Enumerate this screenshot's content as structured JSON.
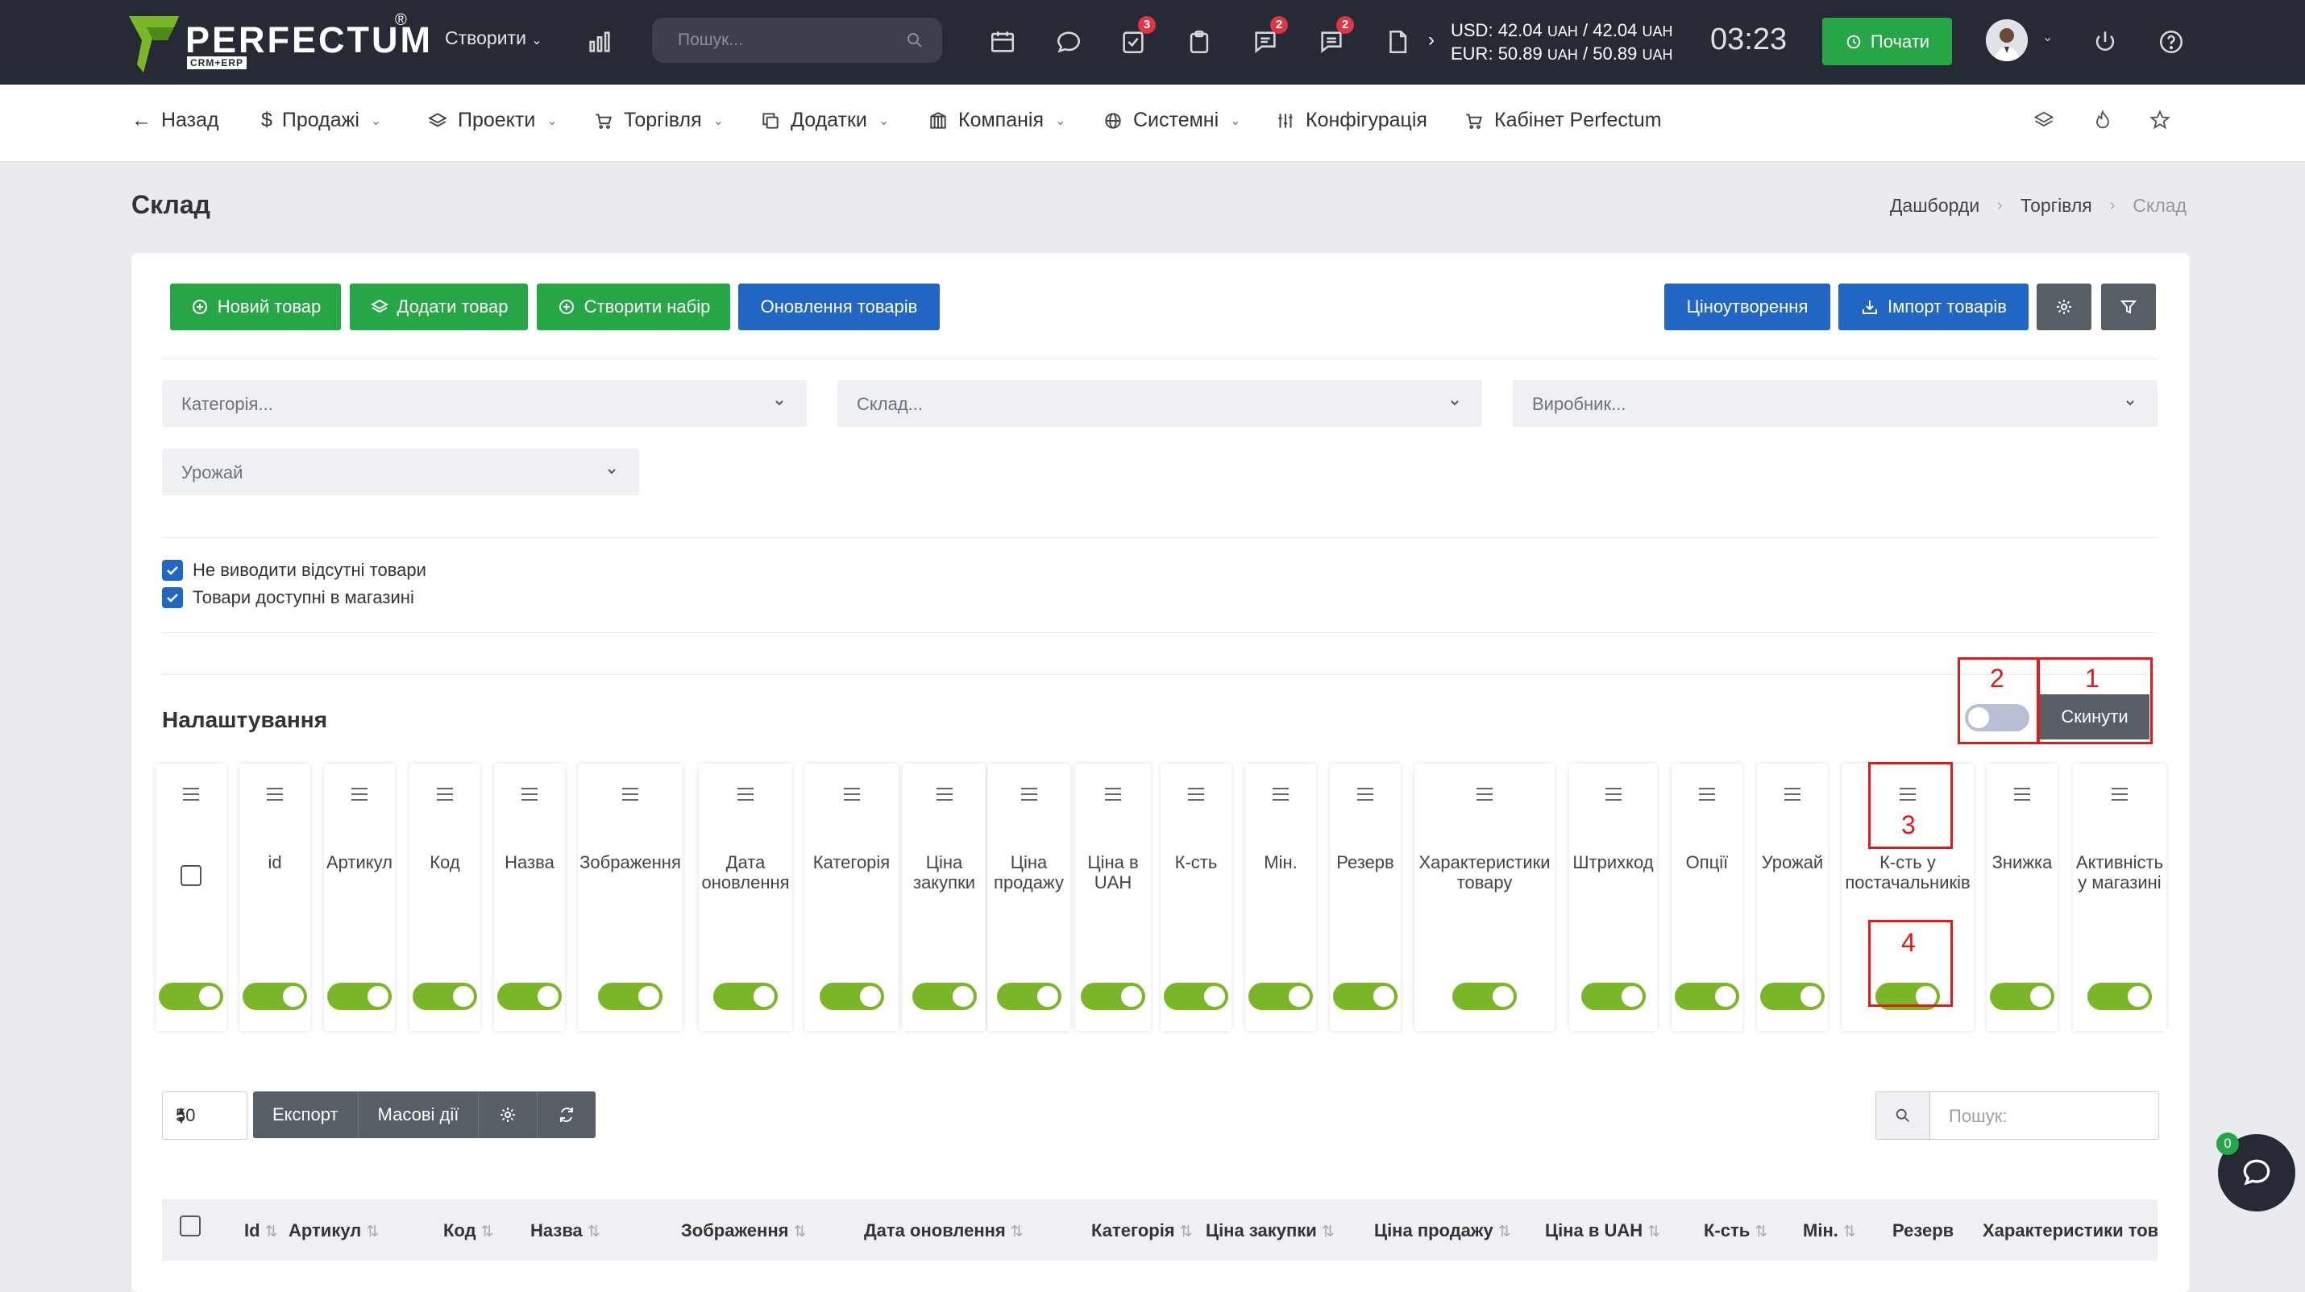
{
  "brand": {
    "name": "PERFECTUM",
    "reg": "®",
    "sub": "CRM+ERP"
  },
  "topbar": {
    "create_label": "Створити",
    "search_placeholder": "Пошук...",
    "badges": {
      "tasks": "3",
      "messages": "2",
      "chat": "2"
    },
    "rates": {
      "usd_label": "USD:",
      "usd_value": "42.04",
      "usd_value2": "42.04",
      "eur_label": "EUR:",
      "eur_value": "50.89",
      "eur_value2": "50.89",
      "currency": "UAH",
      "sep": "/"
    },
    "time": "03:23",
    "start_label": "Почати"
  },
  "nav": {
    "back": "Назад",
    "items": [
      "Продажі",
      "Проекти",
      "Торгівля",
      "Додатки",
      "Компанія",
      "Системні",
      "Конфігурація",
      "Кабінет Perfectum"
    ]
  },
  "page": {
    "title": "Склад",
    "breadcrumb": [
      "Дашборди",
      "Торгівля",
      "Склад"
    ]
  },
  "actions": {
    "new_product": "Новий товар",
    "add_product": "Додати товар",
    "create_set": "Створити набір",
    "update_products": "Оновлення товарів",
    "pricing": "Ціноутворення",
    "import": "Імпорт товарів"
  },
  "filters": {
    "category": "Категорія...",
    "warehouse": "Склад...",
    "manufacturer": "Виробник...",
    "harvest": "Урожай"
  },
  "checks": {
    "hide_missing": "Не виводити відсутні товари",
    "in_store": "Товари доступні в магазині"
  },
  "settings": {
    "title": "Налаштування",
    "reset": "Скинути",
    "master_toggle": false,
    "annotations": [
      "1",
      "2",
      "3",
      "4"
    ],
    "columns": [
      {
        "label": "",
        "on": true
      },
      {
        "label": "id",
        "on": true
      },
      {
        "label": "Артикул",
        "on": true
      },
      {
        "label": "Код",
        "on": true
      },
      {
        "label": "Назва",
        "on": true
      },
      {
        "label": "Зображення",
        "on": true
      },
      {
        "label": "Дата оновлення",
        "on": true
      },
      {
        "label": "Категорія",
        "on": true
      },
      {
        "label": "Ціна закупки",
        "on": true
      },
      {
        "label": "Ціна продажу",
        "on": true
      },
      {
        "label": "Ціна в UAH",
        "on": true
      },
      {
        "label": "К-сть",
        "on": true
      },
      {
        "label": "Мін.",
        "on": true
      },
      {
        "label": "Резерв",
        "on": true
      },
      {
        "label": "Характеристики товару",
        "on": true
      },
      {
        "label": "Штрихкод",
        "on": true
      },
      {
        "label": "Опції",
        "on": true
      },
      {
        "label": "Урожай",
        "on": true
      },
      {
        "label": "К-сть у постачальників",
        "on": true
      },
      {
        "label": "Знижка",
        "on": true
      },
      {
        "label": "Активність у магазині",
        "on": true
      }
    ]
  },
  "table": {
    "per_page": "50",
    "export": "Експорт",
    "bulk": "Масові дії",
    "search_placeholder": "Пошук:",
    "headers": [
      "Id",
      "Артикул",
      "Код",
      "Назва",
      "Зображення",
      "Дата оновлення",
      "Категорія",
      "Ціна закупки",
      "Ціна продажу",
      "Ціна в UAH",
      "К-сть",
      "Мін.",
      "Резерв",
      "Характеристики тов"
    ]
  },
  "chat": {
    "badge": "0"
  },
  "colors": {
    "topbar": "#262a34",
    "green": "#26a646",
    "blue": "#2266c4",
    "gray": "#585e66",
    "toggle_on": "#7ab728",
    "toggle_off": "#b9c0d6",
    "annotation": "#e01b1b",
    "badge": "#e03545"
  }
}
